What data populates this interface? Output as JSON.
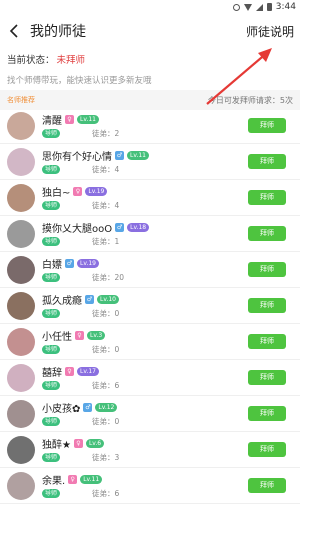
{
  "status_bar": {
    "time": "3:44"
  },
  "header": {
    "title": "我的师徒",
    "help_link": "师徒说明"
  },
  "status": {
    "label": "当前状态：",
    "value": "未拜师"
  },
  "hint": "找个师傅带玩，能快速认识更多新友哦",
  "section": {
    "title": "名师推荐",
    "daily_requests": "今日可发拜师请求：5次"
  },
  "colors": {
    "accent_green": "#4ec43f",
    "status_red": "#e04040",
    "section_orange": "#f0903a"
  },
  "rows": [
    {
      "name": "清醒",
      "sex": "♀",
      "level": "Lv.11",
      "teacher": "导师",
      "disciples": "徒弟：2",
      "button": "拜师"
    },
    {
      "name": "思你有个好心情",
      "sex": "♂",
      "level": "Lv.11",
      "teacher": "导师",
      "disciples": "徒弟：4",
      "button": "拜师"
    },
    {
      "name": "独白~",
      "sex": "♀",
      "level": "Lv.19",
      "teacher": "导师",
      "disciples": "徒弟：4",
      "button": "拜师"
    },
    {
      "name": "摸你乂大腿ooO",
      "sex": "♂",
      "level": "Lv.18",
      "teacher": "导师",
      "disciples": "徒弟：1",
      "button": "拜师"
    },
    {
      "name": "白嫖",
      "sex": "♂",
      "level": "Lv.19",
      "teacher": "导师",
      "disciples": "徒弟：20",
      "button": "拜师"
    },
    {
      "name": "孤久成瘾",
      "sex": "♂",
      "level": "Lv.10",
      "teacher": "导师",
      "disciples": "徒弟：0",
      "button": "拜师"
    },
    {
      "name": "小任性",
      "sex": "♀",
      "level": "Lv.3",
      "teacher": "导师",
      "disciples": "徒弟：0",
      "button": "拜师"
    },
    {
      "name": "囍辞",
      "sex": "♀",
      "level": "Lv.17",
      "teacher": "导师",
      "disciples": "徒弟：6",
      "button": "拜师"
    },
    {
      "name": "小皮孩✿",
      "sex": "♂",
      "level": "Lv.12",
      "teacher": "导师",
      "disciples": "徒弟：0",
      "button": "拜师"
    },
    {
      "name": "独醉★",
      "sex": "♀",
      "level": "Lv.6",
      "teacher": "导师",
      "disciples": "徒弟：3",
      "button": "拜师"
    },
    {
      "name": "余果.",
      "sex": "♀",
      "level": "Lv.11",
      "teacher": "导师",
      "disciples": "徒弟：6",
      "button": "拜师"
    }
  ]
}
